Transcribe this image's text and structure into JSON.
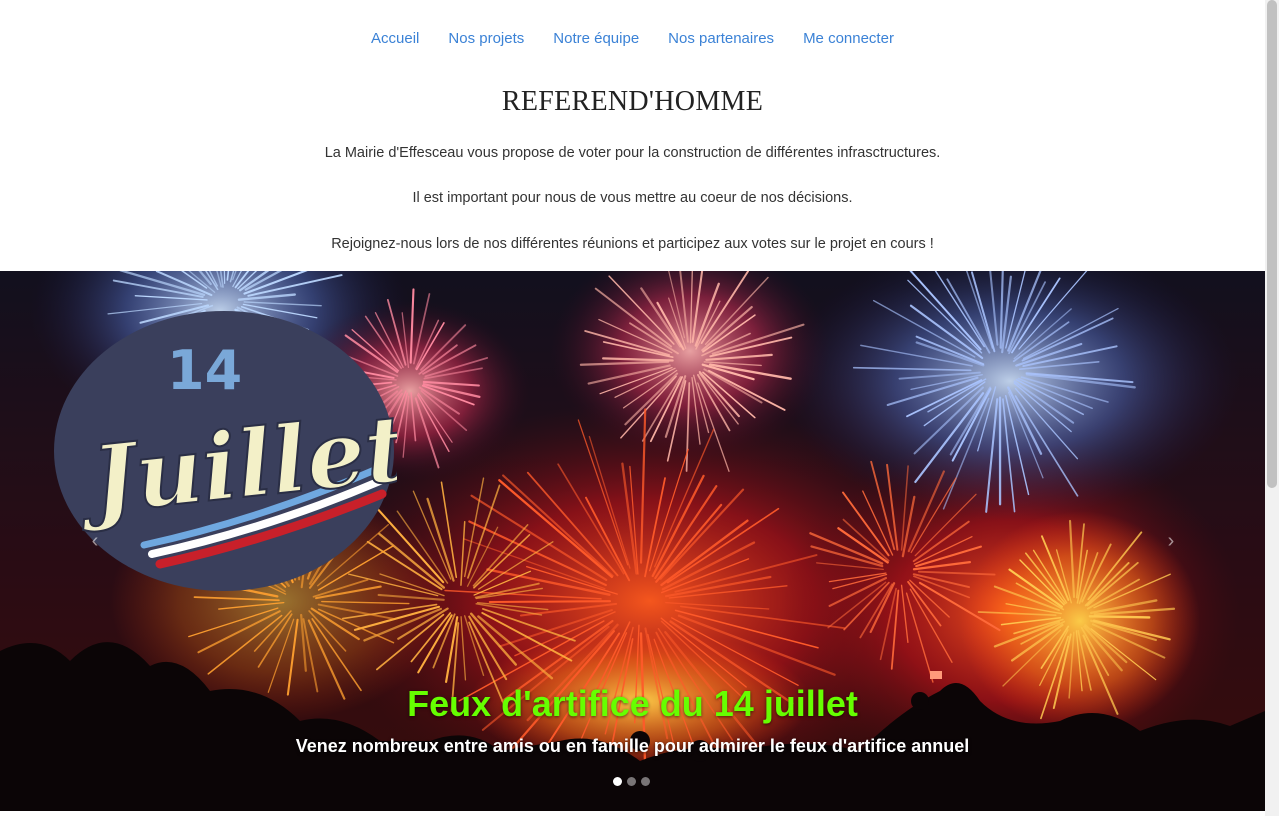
{
  "nav": {
    "items": [
      {
        "label": "Accueil"
      },
      {
        "label": "Nos projets"
      },
      {
        "label": "Notre équipe"
      },
      {
        "label": "Nos partenaires"
      },
      {
        "label": "Me connecter"
      }
    ]
  },
  "header": {
    "title": "REFEREND'HOMME",
    "paragraphs": [
      "La Mairie d'Effesceau vous propose de voter pour la construction de différentes infrasctructures.",
      "Il est important pour nous de vous mettre au coeur de nos décisions.",
      "Rejoignez-nous lors de nos différentes réunions et participez aux votes sur le projet en cours !"
    ]
  },
  "carousel": {
    "badge": {
      "number": "14",
      "word": "Juillet"
    },
    "caption_title": "Feux d'artifice du 14 juillet",
    "caption_text": "Venez nombreux entre amis ou en famille pour admirer le feux d'artifice annuel",
    "prev_icon": "chevron-left-icon",
    "next_icon": "chevron-right-icon",
    "slide_count": 3,
    "active_index": 0,
    "caption_color": "#66ff00"
  },
  "colors": {
    "link": "#3b82d6",
    "badge_bg": "#3a3f5c",
    "badge_text": "#f3f0c8"
  }
}
